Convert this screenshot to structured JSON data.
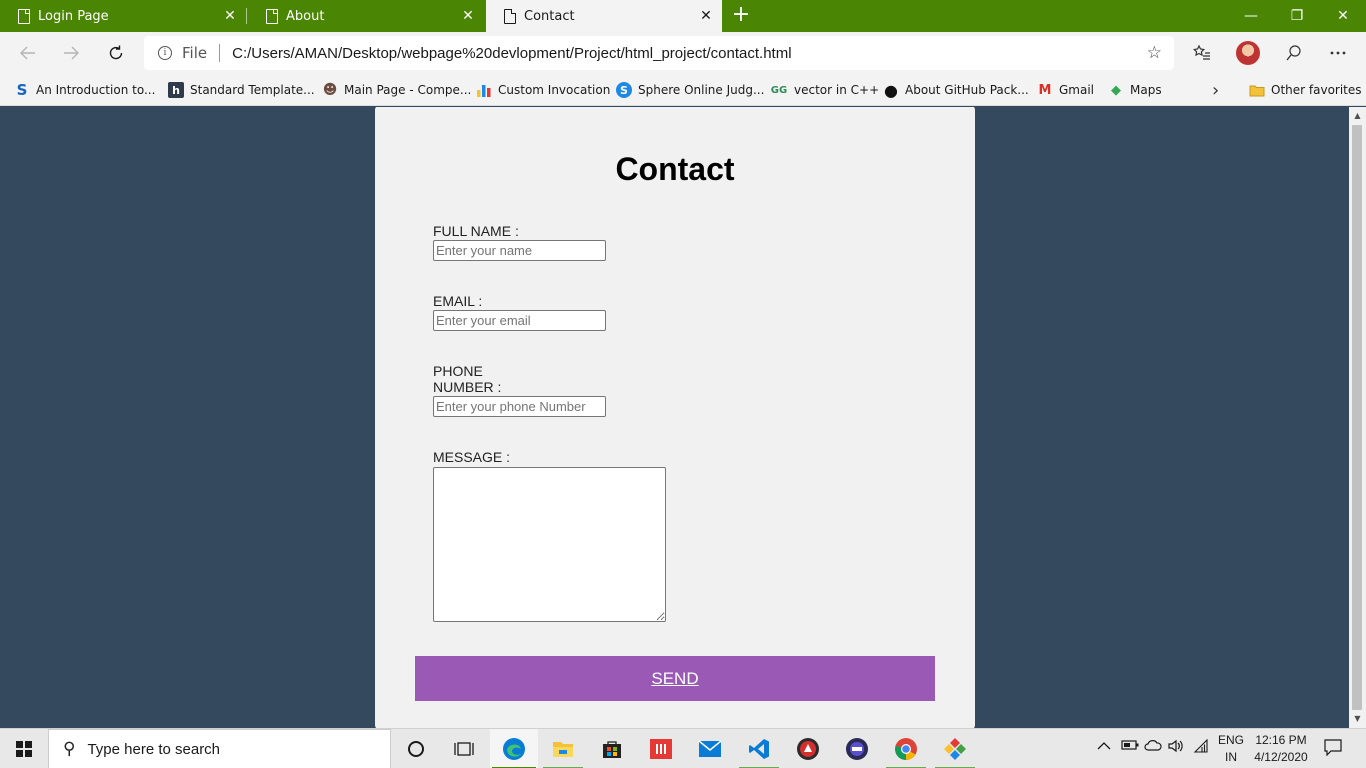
{
  "browser": {
    "tabs": [
      {
        "label": "Login Page",
        "close": "✕"
      },
      {
        "label": "About",
        "close": "✕"
      },
      {
        "label": "Contact",
        "close": "✕"
      }
    ],
    "new_tab": "+",
    "window_controls": {
      "minimize": "—",
      "restore": "❐",
      "close": "✕"
    },
    "address": {
      "info": "i",
      "scheme_label": "File",
      "url": "C:/Users/AMAN/Desktop/webpage%20devlopment/Project/html_project/contact.html",
      "star": "☆"
    },
    "toolbar_icons": [
      "back-arrow-icon",
      "forward-arrow-icon",
      "refresh-icon",
      "favorites-list-icon",
      "profile-avatar",
      "feedback-icon",
      "more-icon"
    ],
    "favorites": [
      {
        "label": "An Introduction to...",
        "icon": "S"
      },
      {
        "label": "Standard Template...",
        "icon": "h"
      },
      {
        "label": "Main Page - Compe...",
        "icon": "☻"
      },
      {
        "label": "Custom Invocation",
        "icon": "▮"
      },
      {
        "label": "Sphere Online Judg...",
        "icon": "S"
      },
      {
        "label": "vector in C++",
        "icon": "GG"
      },
      {
        "label": "About GitHub Pack...",
        "icon": "●"
      },
      {
        "label": "Gmail",
        "icon": "M"
      },
      {
        "label": "Maps",
        "icon": "◆"
      }
    ],
    "favorites_more": "›",
    "other_favorites": "Other favorites",
    "colors": {
      "accent": "#4a8604",
      "page_bg": "#34495e",
      "button": "#9b59b6"
    }
  },
  "page": {
    "title": "Contact",
    "fields": {
      "name": {
        "label": "FULL NAME :",
        "placeholder": "Enter your name"
      },
      "email": {
        "label": "EMAIL :",
        "placeholder": "Enter your email"
      },
      "phone": {
        "label_line1": "PHONE",
        "label_line2": "NUMBER :",
        "placeholder": "Enter your phone Number"
      },
      "message": {
        "label": "MESSAGE :"
      }
    },
    "send_label": "SEND"
  },
  "taskbar": {
    "search_placeholder": "Type here to search",
    "apps": [
      "cortana-icon",
      "task-view-icon",
      "edge-icon",
      "file-explorer-icon",
      "store-icon",
      "office-icon",
      "mail-icon",
      "vscode-icon",
      "app-red-icon",
      "app-blue-icon",
      "chrome-icon",
      "app-diamond-icon"
    ],
    "language": {
      "line1": "ENG",
      "line2": "IN"
    },
    "time": "12:16 PM",
    "date": "4/12/2020"
  }
}
